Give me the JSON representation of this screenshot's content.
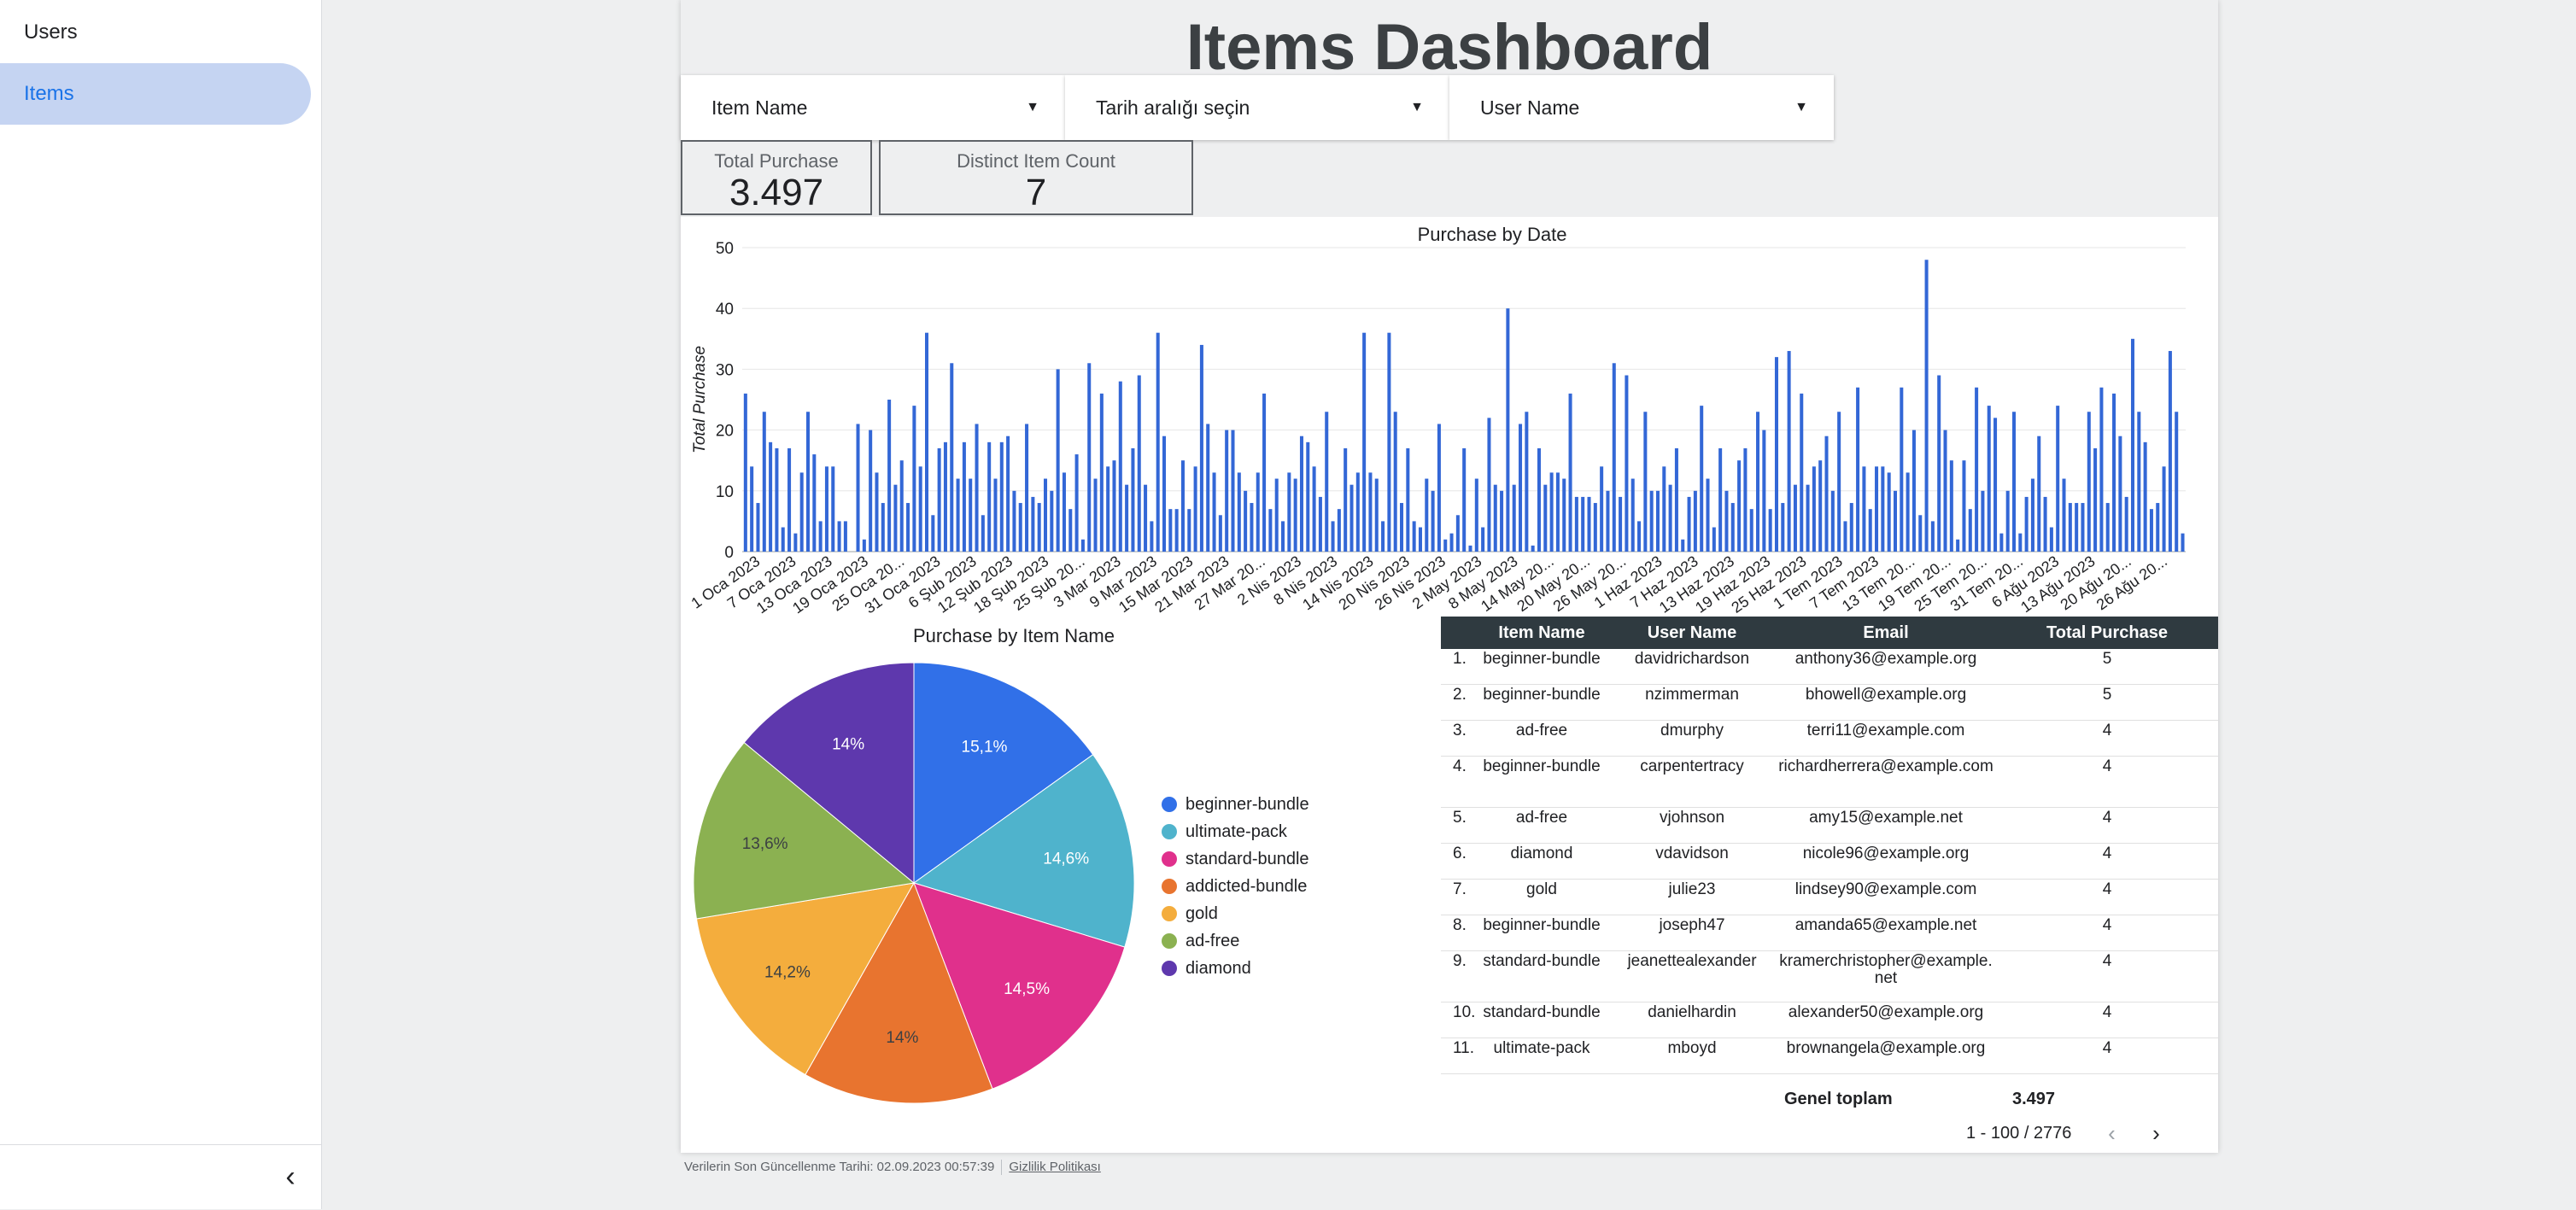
{
  "sidebar": {
    "items": [
      {
        "label": "Users",
        "active": false
      },
      {
        "label": "Items",
        "active": true
      }
    ],
    "collapse_icon": "chevron-left-icon"
  },
  "report": {
    "title": "Items Dashboard",
    "filters": [
      {
        "label": "Item Name",
        "icon": "dropdown-arrow-icon"
      },
      {
        "label": "Tarih aralığı seçin",
        "icon": "dropdown-arrow-icon"
      },
      {
        "label": "User Name",
        "icon": "dropdown-arrow-icon"
      }
    ],
    "scorecards": [
      {
        "label": "Total Purchase",
        "value": "3.497"
      },
      {
        "label": "Distinct Item Count",
        "value": "7"
      }
    ]
  },
  "chart_data": [
    {
      "type": "bar",
      "title": "Purchase by Date",
      "xlabel": "",
      "ylabel": "Total Purchase",
      "ylim": [
        0,
        50
      ],
      "yticks": [
        0,
        10,
        20,
        30,
        40,
        50
      ],
      "grid": true,
      "color": "#3367d6",
      "x_tick_labels": [
        "1 Oca 2023",
        "7 Oca 2023",
        "13 Oca 2023",
        "19 Oca 2023",
        "25 Oca 20...",
        "31 Oca 2023",
        "6 Şub 2023",
        "12 Şub 2023",
        "18 Şub 2023",
        "25 Şub 20...",
        "3 Mar 2023",
        "9 Mar 2023",
        "15 Mar 2023",
        "21 Mar 2023",
        "27 Mar 20...",
        "2 Nis 2023",
        "8 Nis 2023",
        "14 Nis 2023",
        "20 Nis 2023",
        "26 Nis 2023",
        "2 May 2023",
        "8 May 2023",
        "14 May 20...",
        "20 May 20...",
        "26 May 20...",
        "1 Haz 2023",
        "7 Haz 2023",
        "13 Haz 2023",
        "19 Haz 2023",
        "25 Haz 2023",
        "1 Tem 2023",
        "7 Tem 2023",
        "13 Tem 20...",
        "19 Tem 20...",
        "25 Tem 20...",
        "31 Tem 20...",
        "6 Ağu 2023",
        "13 Ağu 2023",
        "20 Ağu 20...",
        "26 Ağu 20..."
      ],
      "values": [
        26,
        14,
        8,
        23,
        18,
        17,
        4,
        17,
        3,
        13,
        23,
        16,
        5,
        14,
        14,
        5,
        5,
        0,
        21,
        2,
        20,
        13,
        8,
        25,
        11,
        15,
        8,
        24,
        14,
        36,
        6,
        17,
        18,
        31,
        12,
        18,
        12,
        21,
        6,
        18,
        12,
        18,
        19,
        10,
        8,
        21,
        9,
        8,
        12,
        10,
        30,
        13,
        7,
        16,
        2,
        31,
        12,
        26,
        14,
        15,
        28,
        11,
        17,
        29,
        11,
        5,
        36,
        19,
        7,
        7,
        15,
        7,
        14,
        34,
        21,
        13,
        6,
        20,
        20,
        13,
        10,
        8,
        13,
        26,
        7,
        12,
        5,
        13,
        12,
        19,
        18,
        14,
        9,
        23,
        5,
        7,
        17,
        11,
        13,
        36,
        13,
        12,
        5,
        36,
        23,
        8,
        17,
        5,
        4,
        12,
        10,
        21,
        2,
        3,
        6,
        17,
        1,
        12,
        4,
        22,
        11,
        10,
        40,
        11,
        21,
        23,
        1,
        17,
        11,
        13,
        13,
        12,
        26,
        9,
        9,
        9,
        8,
        14,
        10,
        31,
        9,
        29,
        12,
        5,
        23,
        10,
        10,
        14,
        11,
        17,
        2,
        9,
        10,
        24,
        12,
        4,
        17,
        10,
        8,
        15,
        17,
        7,
        23,
        20,
        7,
        32,
        8,
        33,
        11,
        26,
        11,
        14,
        15,
        19,
        10,
        23,
        5,
        8,
        27,
        14,
        7,
        14,
        14,
        13,
        10,
        27,
        13,
        20,
        6,
        48,
        5,
        29,
        20,
        15,
        2,
        15,
        7,
        27,
        10,
        24,
        22,
        3,
        10,
        23,
        3,
        9,
        12,
        19,
        9,
        4,
        24,
        12,
        8,
        8,
        8,
        23,
        17,
        27,
        8,
        26,
        19,
        9,
        35,
        23,
        18,
        7,
        8,
        14,
        33,
        23,
        3
      ]
    },
    {
      "type": "pie",
      "title": "Purchase by Item Name",
      "legend_position": "right",
      "slices": [
        {
          "label": "beginner-bundle",
          "value": 15.1,
          "text": "15,1%",
          "color": "#3170e8"
        },
        {
          "label": "ultimate-pack",
          "value": 14.6,
          "text": "14,6%",
          "color": "#4fb3cc"
        },
        {
          "label": "standard-bundle",
          "value": 14.5,
          "text": "14,5%",
          "color": "#e0308c"
        },
        {
          "label": "addicted-bundle",
          "value": 14.0,
          "text": "14%",
          "color": "#e8742f"
        },
        {
          "label": "gold",
          "value": 14.2,
          "text": "14,2%",
          "color": "#f4ad3d"
        },
        {
          "label": "ad-free",
          "value": 13.6,
          "text": "13,6%",
          "color": "#8bb151"
        },
        {
          "label": "diamond",
          "value": 14.0,
          "text": "14%",
          "color": "#5e38ad"
        }
      ]
    },
    {
      "type": "table",
      "columns": [
        "Item Name",
        "User Name",
        "Email",
        "Total Purchase"
      ],
      "rows": [
        [
          "1.",
          "beginner-bundle",
          "davidrichardson",
          "anthony36@example.org",
          "5"
        ],
        [
          "2.",
          "beginner-bundle",
          "nzimmerman",
          "bhowell@example.org",
          "5"
        ],
        [
          "3.",
          "ad-free",
          "dmurphy",
          "terri11@example.com",
          "4"
        ],
        [
          "4.",
          "beginner-bundle",
          "carpentertracy",
          "richardherrera@example.com",
          "4"
        ],
        [
          "5.",
          "ad-free",
          "vjohnson",
          "amy15@example.net",
          "4"
        ],
        [
          "6.",
          "diamond",
          "vdavidson",
          "nicole96@example.org",
          "4"
        ],
        [
          "7.",
          "gold",
          "julie23",
          "lindsey90@example.com",
          "4"
        ],
        [
          "8.",
          "beginner-bundle",
          "joseph47",
          "amanda65@example.net",
          "4"
        ],
        [
          "9.",
          "standard-bundle",
          "jeanettealexander",
          "kramerchristopher@example.net",
          "4"
        ],
        [
          "10.",
          "standard-bundle",
          "danielhardin",
          "alexander50@example.org",
          "4"
        ],
        [
          "11.",
          "ultimate-pack",
          "mboyd",
          "brownangela@example.org",
          "4"
        ]
      ],
      "totals_label": "Genel toplam",
      "totals_value": "3.497",
      "pagination": "1 - 100 / 2776"
    }
  ],
  "footer": {
    "updated": "Verilerin Son Güncellenme Tarihi: 02.09.2023 00:57:39",
    "privacy": "Gizlilik Politikası"
  }
}
